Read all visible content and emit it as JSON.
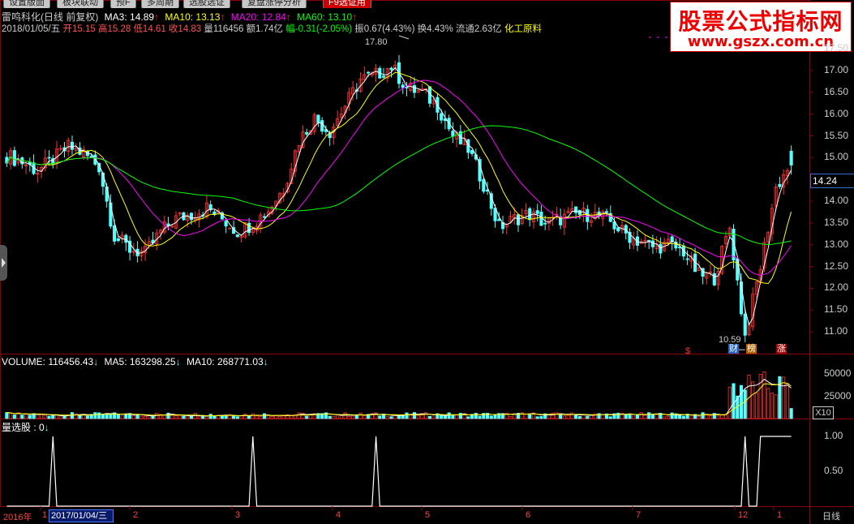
{
  "tabs": [
    "设置版面",
    "板块联动",
    "预F",
    "多周期",
    "选股选证",
    "复盘涨停分析",
    "F9选证用"
  ],
  "tabs_active_index": 6,
  "header": {
    "name_period": "雷鸣科化(日线 前复权)",
    "ma": [
      {
        "label": "MA3: 14.89",
        "color": "#ffffff"
      },
      {
        "label": "MA10: 13.13",
        "color": "#ffff00"
      },
      {
        "label": "MA20: 12.84",
        "color": "#ff00ff"
      },
      {
        "label": "MA60: 13.10",
        "color": "#00ff00"
      }
    ],
    "up_arrow": "↑",
    "quote_items": [
      {
        "text": "2018/01/05/五",
        "color": "#cccccc"
      },
      {
        "text": "开15.15",
        "color": "#ff5050"
      },
      {
        "text": "高15.28",
        "color": "#ff5050"
      },
      {
        "text": "低14.61",
        "color": "#ff5050"
      },
      {
        "text": "收14.83",
        "color": "#ff5050"
      },
      {
        "text": "量116456",
        "color": "#cccccc"
      },
      {
        "text": "额1.74亿",
        "color": "#cccccc"
      },
      {
        "text": "幅-0.31(-2.05%)",
        "color": "#00ff00"
      },
      {
        "text": "振0.67(4.43%)",
        "color": "#cccccc"
      },
      {
        "text": "换4.43%",
        "color": "#cccccc"
      },
      {
        "text": "流通2.63亿",
        "color": "#cccccc"
      },
      {
        "text": "化工原料",
        "color": "#ffff00"
      }
    ]
  },
  "logo": {
    "line1": "股票公式指标网",
    "line2": "www.gszx.com.cn"
  },
  "colors": {
    "up": "#ff3232",
    "down": "#54ffff",
    "grid": "#8b0000",
    "ma3": "#ffffff",
    "ma10": "#ffff00",
    "ma20": "#ff00ff",
    "ma60": "#00ff00",
    "select_box": "#4a7aff"
  },
  "price_axis": {
    "ticks": [
      "17.50",
      "17.00",
      "16.50",
      "16.00",
      "15.50",
      "15.00",
      "14.50",
      "14.00",
      "13.50",
      "13.00",
      "12.50",
      "12.00",
      "11.50",
      "11.00"
    ],
    "current": "14.24"
  },
  "annotations": {
    "high_label": "17.80",
    "low_label": "10.59",
    "tags": [
      "$",
      "财",
      "榜",
      "涨"
    ]
  },
  "volume_panel": {
    "header": [
      {
        "label": "VOLUME: 116456.43",
        "color": "#ffffff"
      },
      {
        "label": "MA5: 163298.25",
        "color": "#ffffff"
      },
      {
        "label": "MA10: 268771.03",
        "color": "#ffffff"
      }
    ],
    "down_arrow": "↓",
    "ticks": [
      "50000",
      "25000"
    ],
    "unit": "X10"
  },
  "signal_panel": {
    "header": "量选股 : 0",
    "ticks": [
      "1.00",
      "0.50"
    ]
  },
  "x_axis": {
    "labels": [
      "2016年",
      "1",
      "2",
      "3",
      "4",
      "5",
      "6",
      "7",
      "12",
      "1"
    ],
    "selected_date": "2017/01/04/三",
    "period": "日线"
  },
  "chart_data": {
    "type": "candlestick",
    "title": "雷鸣科化(日线 前复权)",
    "ylim": [
      10.5,
      17.8
    ],
    "x_range": [
      "2016-12",
      "2018-01-05"
    ],
    "last_candle": {
      "date": "2018/01/05",
      "open": 15.15,
      "high": 15.28,
      "low": 14.61,
      "close": 14.83,
      "volume": 116456
    },
    "ma_latest": {
      "MA3": 14.89,
      "MA10": 13.13,
      "MA20": 12.84,
      "MA60": 13.1
    },
    "period_high": 17.8,
    "period_low": 10.59,
    "close_path": [
      15.05,
      14.9,
      14.7,
      14.95,
      15.25,
      15.1,
      14.8,
      13.2,
      12.9,
      12.8,
      13.3,
      13.6,
      13.7,
      13.85,
      13.6,
      13.3,
      13.5,
      13.8,
      14.3,
      15.4,
      15.9,
      15.6,
      16.2,
      16.8,
      16.9,
      17.1,
      16.6,
      16.5,
      16.2,
      15.5,
      15.2,
      14.4,
      13.4,
      13.6,
      13.7,
      13.5,
      13.6,
      13.7,
      13.7,
      13.6,
      13.3,
      13.1,
      12.95,
      13.0,
      12.85,
      12.3,
      12.25,
      13.4,
      10.9,
      12.5,
      14.3,
      14.9
    ],
    "volume_ma5_latest": 163298.25,
    "volume_ma10_latest": 268771.03,
    "signal_spikes_at_index": [
      3,
      16,
      24,
      48
    ],
    "signal_plateau_index_range": [
      49,
      51
    ]
  }
}
